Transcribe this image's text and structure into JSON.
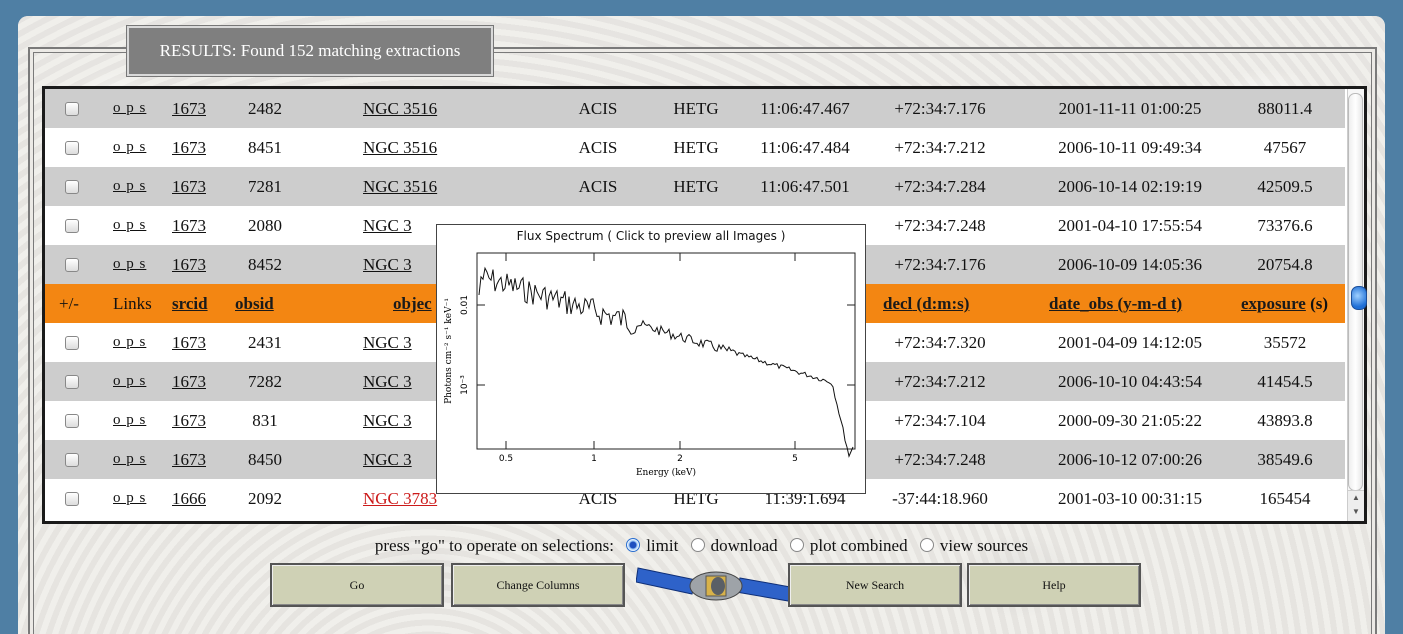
{
  "results_title": "RESULTS: Found 152 matching extractions",
  "links_text": "o p s",
  "rows_top": [
    {
      "srcid": "1673",
      "obsid": "2482",
      "object": "NGC 3516",
      "instrument": "ACIS",
      "grating": "HETG",
      "ra": "11:06:47.467",
      "decl": "+72:34:7.176",
      "date_obs": "2001-11-11 01:00:25",
      "exposure": "88011.4"
    },
    {
      "srcid": "1673",
      "obsid": "8451",
      "object": "NGC 3516",
      "instrument": "ACIS",
      "grating": "HETG",
      "ra": "11:06:47.484",
      "decl": "+72:34:7.212",
      "date_obs": "2006-10-11 09:49:34",
      "exposure": "47567"
    },
    {
      "srcid": "1673",
      "obsid": "7281",
      "object": "NGC 3516",
      "instrument": "ACIS",
      "grating": "HETG",
      "ra": "11:06:47.501",
      "decl": "+72:34:7.284",
      "date_obs": "2006-10-14 02:19:19",
      "exposure": "42509.5"
    },
    {
      "srcid": "1673",
      "obsid": "2080",
      "object": "NGC 3",
      "decl": "+72:34:7.248",
      "date_obs": "2001-04-10 17:55:54",
      "exposure": "73376.6"
    },
    {
      "srcid": "1673",
      "obsid": "8452",
      "object": "NGC 3",
      "decl": "+72:34:7.176",
      "date_obs": "2006-10-09 14:05:36",
      "exposure": "20754.8"
    }
  ],
  "header": {
    "select": "+/-",
    "links": "Links",
    "srcid": "srcid",
    "obsid": "obsid",
    "object": "objec",
    "decl": "decl",
    "decl_unit": " (d:m:s)",
    "date_obs": "date_obs",
    "date_unit": " (y-m-d t)",
    "exposure": "exposure",
    "exposure_unit": " (s)"
  },
  "rows_bottom": [
    {
      "srcid": "1673",
      "obsid": "2431",
      "object": "NGC 3",
      "decl": "+72:34:7.320",
      "date_obs": "2001-04-09 14:12:05",
      "exposure": "35572"
    },
    {
      "srcid": "1673",
      "obsid": "7282",
      "object": "NGC 3",
      "decl": "+72:34:7.212",
      "date_obs": "2006-10-10 04:43:54",
      "exposure": "41454.5"
    },
    {
      "srcid": "1673",
      "obsid": "831",
      "object": "NGC 3",
      "decl": "+72:34:7.104",
      "date_obs": "2000-09-30 21:05:22",
      "exposure": "43893.8"
    },
    {
      "srcid": "1673",
      "obsid": "8450",
      "object": "NGC 3",
      "decl": "+72:34:7.248",
      "date_obs": "2006-10-12 07:00:26",
      "exposure": "38549.6"
    },
    {
      "srcid": "1666",
      "obsid": "2092",
      "object": "NGC 3783",
      "instrument": "ACIS",
      "grating": "HETG",
      "ra": "11:39:1.694",
      "decl": "-37:44:18.960",
      "date_obs": "2001-03-10 00:31:15",
      "exposure": "165454"
    }
  ],
  "popup": {
    "title": "Flux Spectrum ( Click to preview all Images )",
    "xlabel": "Energy (keV)",
    "ylabel": "Photons cm⁻² s⁻¹ keV⁻¹",
    "xticks": [
      "0.5",
      "1",
      "2",
      "5"
    ],
    "yticks": [
      "0.01",
      "10⁻³"
    ]
  },
  "operations": {
    "prompt": "press \"go\" to operate on selections:",
    "options": [
      "limit",
      "download",
      "plot combined",
      "view sources"
    ],
    "selected": "limit"
  },
  "buttons": {
    "go": "Go",
    "change_columns": "Change Columns",
    "new_search": "New Search",
    "help": "Help"
  }
}
